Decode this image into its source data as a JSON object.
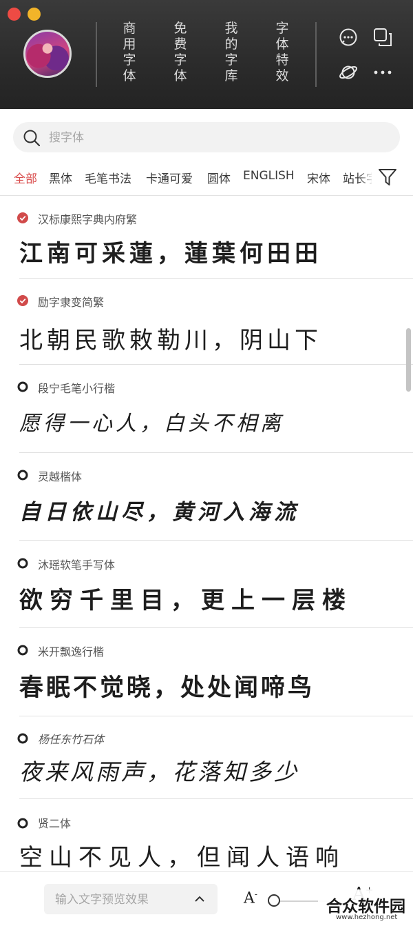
{
  "header": {
    "nav_tabs": [
      {
        "label": "商用字体"
      },
      {
        "label": "免费字体"
      },
      {
        "label": "我的字库"
      },
      {
        "label": "字体特效"
      }
    ]
  },
  "search": {
    "placeholder": "搜字体"
  },
  "categories": [
    {
      "label": "全部",
      "active": true
    },
    {
      "label": "黑体"
    },
    {
      "label": "毛笔书法"
    },
    {
      "label": "卡通可爱"
    },
    {
      "label": "圆体"
    },
    {
      "label": "ENGLISH"
    },
    {
      "label": "宋体"
    },
    {
      "label": "站长字"
    }
  ],
  "fonts": [
    {
      "name": "汉标康熙字典内府繁",
      "preview": "江南可采蓮，蓮葉何田田",
      "status": "downloaded"
    },
    {
      "name": "励字隶变简繁",
      "preview": "北朝民歌敕勒川，阴山下",
      "status": "downloaded"
    },
    {
      "name": "段宁毛笔小行楷",
      "preview": "愿得一心人，白头不相离",
      "status": "not-downloaded"
    },
    {
      "name": "灵越楷体",
      "preview": "自日依山尽，黄河入海流",
      "status": "not-downloaded"
    },
    {
      "name": "沐瑶软笔手写体",
      "preview": "欲穷千里目，更上一层楼",
      "status": "not-downloaded"
    },
    {
      "name": "米开飘逸行楷",
      "preview": "春眠不觉晓，处处闻啼鸟",
      "status": "not-downloaded"
    },
    {
      "name": "杨任东竹石体",
      "preview": "夜来风雨声，花落知多少",
      "status": "not-downloaded"
    },
    {
      "name": "贤二体",
      "preview": "空山不见人，但闻人语响",
      "status": "not-downloaded"
    }
  ],
  "bottom_bar": {
    "preview_placeholder": "输入文字预览效果",
    "font_size_small_label": "A",
    "font_size_large_label": "A",
    "font_size_small_sup": "-",
    "font_size_large_sup": "+",
    "slider_level": 0
  },
  "watermark": {
    "title": "合众软件园",
    "url": "www.hezhong.net"
  },
  "colors": {
    "accent": "#d94d4d",
    "header_bg": "#2c2c2c",
    "downloaded": "#d14a4a"
  }
}
